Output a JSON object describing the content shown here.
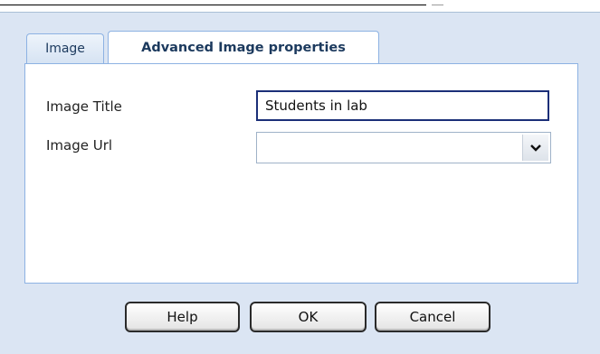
{
  "tabs": [
    {
      "label": "Image"
    },
    {
      "label": "Advanced Image properties"
    }
  ],
  "form": {
    "image_title_label": "Image Title",
    "image_title_value": "Students in lab",
    "image_url_label": "Image Url",
    "image_url_value": ""
  },
  "buttons": {
    "help": "Help",
    "ok": "OK",
    "cancel": "Cancel"
  },
  "icons": {
    "dropdown": "chevron-down-icon"
  },
  "colors": {
    "dialog_bg": "#dbe5f3",
    "tab_border": "#8db2e3",
    "input_focus_border": "#1b2f78"
  }
}
